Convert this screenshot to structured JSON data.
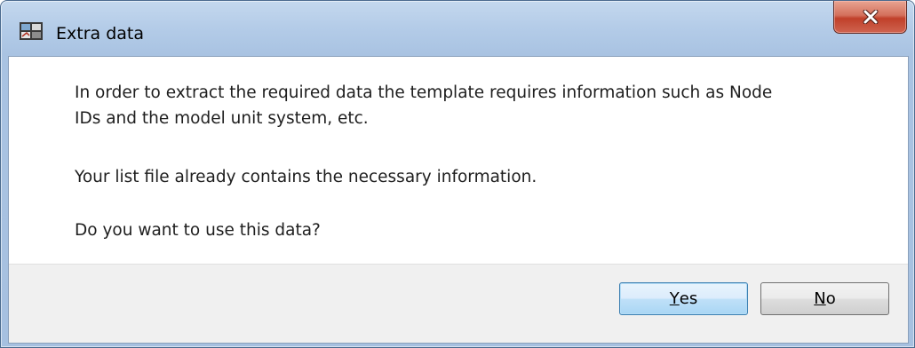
{
  "window": {
    "title": "Extra data",
    "app_icon": "application-icon",
    "close_icon": "close-icon"
  },
  "message": {
    "line1a": "In order to extract the required data the template requires information such as Node",
    "line1b": "IDs and the model unit system, etc.",
    "line2": "Your list file already contains the necessary information.",
    "line3": "Do you want to use this data?"
  },
  "buttons": {
    "yes": {
      "mnemonic": "Y",
      "rest": "es"
    },
    "no": {
      "mnemonic": "N",
      "rest": "o"
    }
  }
}
